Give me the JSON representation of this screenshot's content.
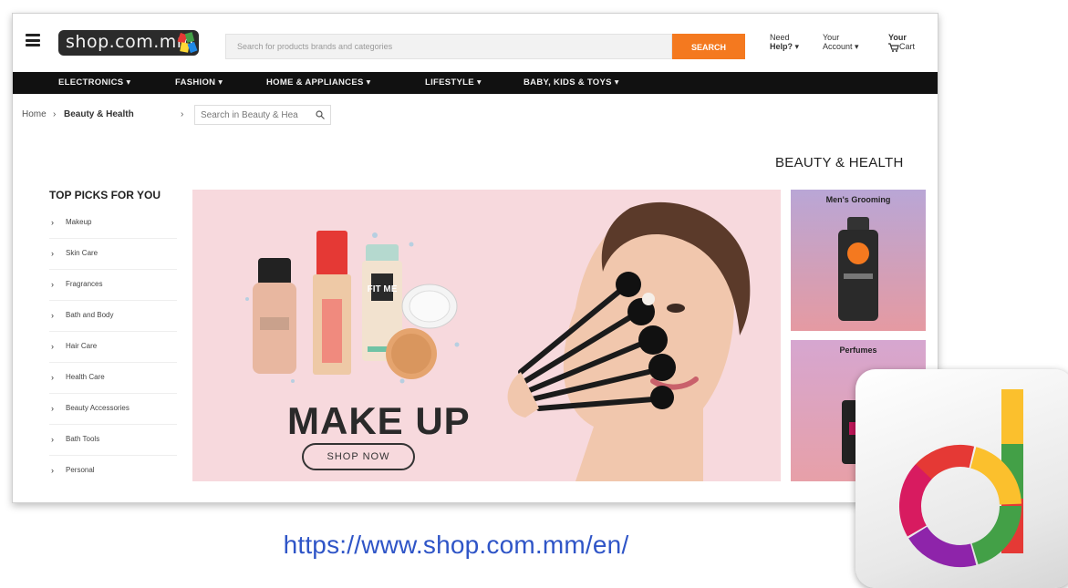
{
  "header": {
    "logo_text": "shop.com.mm",
    "search_placeholder": "Search for products brands and categories",
    "search_button": "SEARCH",
    "help_top": "Need",
    "help_bottom": "Help? ▾",
    "account_top": "Your",
    "account_bottom": "Account ▾",
    "cart_top": "Your",
    "cart_bottom": "Cart"
  },
  "categories": [
    "ELECTRONICS ▾",
    "FASHION ▾",
    "HOME & APPLIANCES ▾",
    "LIFESTYLE ▾",
    "BABY, KIDS & TOYS ▾"
  ],
  "breadcrumb": {
    "home": "Home",
    "sep": "›",
    "current": "Beauty & Health",
    "search_placeholder": "Search in Beauty & Hea"
  },
  "page_heading": "BEAUTY & HEALTH",
  "sidebar": {
    "title": "TOP PICKS FOR YOU",
    "items": [
      "Makeup",
      "Skin Care",
      "Fragrances",
      "Bath and Body",
      "Hair Care",
      "Health Care",
      "Beauty Accessories",
      "Bath Tools",
      "Personal"
    ]
  },
  "banner": {
    "headline": "MAKE UP",
    "cta": "SHOP NOW",
    "bottle_label": "FIT ME"
  },
  "promos": [
    {
      "title": "Men's Grooming"
    },
    {
      "title": "Perfumes"
    }
  ],
  "caption_url": "https://www.shop.com.mm/en/",
  "colors": {
    "accent_orange": "#f4791f",
    "nav_black": "#111111",
    "banner_pink": "#f7d9dd",
    "link_blue": "#2f55c7"
  }
}
